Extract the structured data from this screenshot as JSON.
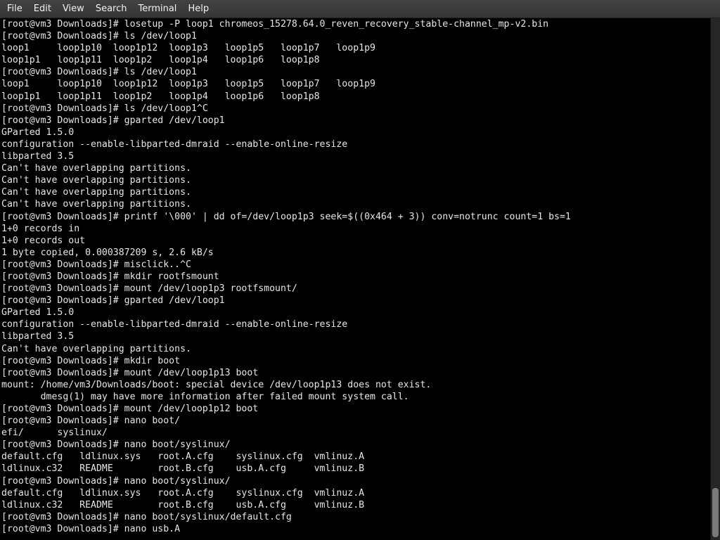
{
  "menubar": {
    "items": [
      "File",
      "Edit",
      "View",
      "Search",
      "Terminal",
      "Help"
    ]
  },
  "terminal": {
    "lines": [
      "[root@vm3 Downloads]# losetup -P loop1 chromeos_15278.64.0_reven_recovery_stable-channel_mp-v2.bin",
      "[root@vm3 Downloads]# ls /dev/loop1",
      "loop1     loop1p10  loop1p12  loop1p3   loop1p5   loop1p7   loop1p9",
      "loop1p1   loop1p11  loop1p2   loop1p4   loop1p6   loop1p8",
      "[root@vm3 Downloads]# ls /dev/loop1",
      "loop1     loop1p10  loop1p12  loop1p3   loop1p5   loop1p7   loop1p9",
      "loop1p1   loop1p11  loop1p2   loop1p4   loop1p6   loop1p8",
      "[root@vm3 Downloads]# ls /dev/loop1^C",
      "[root@vm3 Downloads]# gparted /dev/loop1",
      "GParted 1.5.0",
      "configuration --enable-libparted-dmraid --enable-online-resize",
      "libparted 3.5",
      "Can't have overlapping partitions.",
      "Can't have overlapping partitions.",
      "Can't have overlapping partitions.",
      "Can't have overlapping partitions.",
      "[root@vm3 Downloads]# printf '\\000' | dd of=/dev/loop1p3 seek=$((0x464 + 3)) conv=notrunc count=1 bs=1",
      "1+0 records in",
      "1+0 records out",
      "1 byte copied, 0.000387209 s, 2.6 kB/s",
      "[root@vm3 Downloads]# misclick..^C",
      "[root@vm3 Downloads]# mkdir rootfsmount",
      "[root@vm3 Downloads]# mount /dev/loop1p3 rootfsmount/",
      "[root@vm3 Downloads]# gparted /dev/loop1",
      "GParted 1.5.0",
      "configuration --enable-libparted-dmraid --enable-online-resize",
      "libparted 3.5",
      "Can't have overlapping partitions.",
      "[root@vm3 Downloads]# mkdir boot",
      "[root@vm3 Downloads]# mount /dev/loop1p13 boot",
      "mount: /home/vm3/Downloads/boot: special device /dev/loop1p13 does not exist.",
      "       dmesg(1) may have more information after failed mount system call.",
      "[root@vm3 Downloads]# mount /dev/loop1p12 boot",
      "[root@vm3 Downloads]# nano boot/",
      "efi/      syslinux/",
      "[root@vm3 Downloads]# nano boot/syslinux/",
      "default.cfg   ldlinux.sys   root.A.cfg    syslinux.cfg  vmlinuz.A",
      "ldlinux.c32   README        root.B.cfg    usb.A.cfg     vmlinuz.B",
      "[root@vm3 Downloads]# nano boot/syslinux/",
      "default.cfg   ldlinux.sys   root.A.cfg    syslinux.cfg  vmlinuz.A",
      "ldlinux.c32   README        root.B.cfg    usb.A.cfg     vmlinuz.B",
      "[root@vm3 Downloads]# nano boot/syslinux/default.cfg",
      "[root@vm3 Downloads]# nano usb.A"
    ]
  }
}
